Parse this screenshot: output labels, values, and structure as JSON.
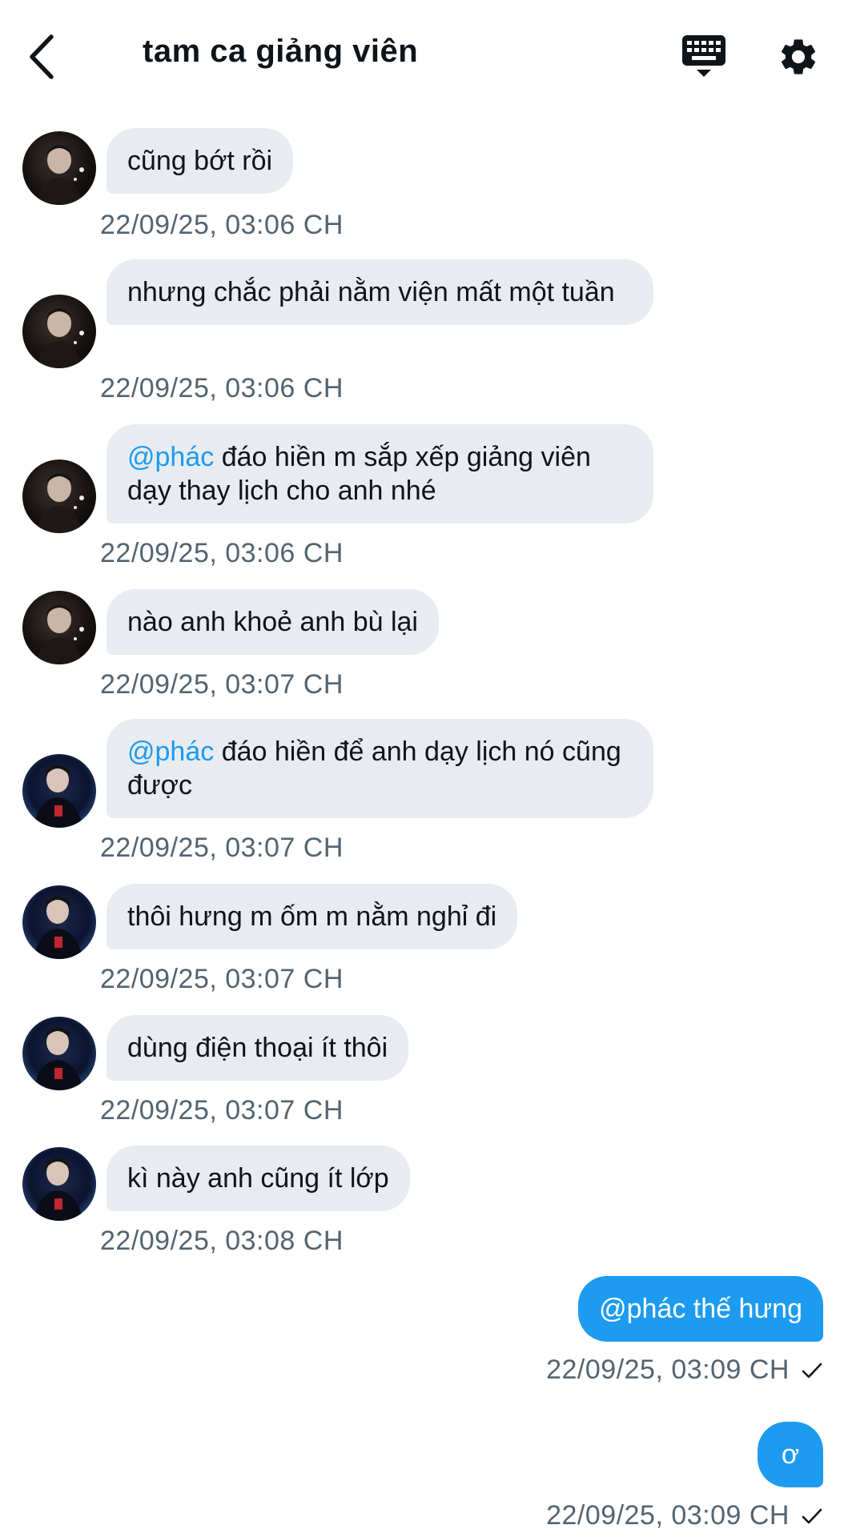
{
  "header": {
    "title": "tam ca giảng viên"
  },
  "messages": [
    {
      "sender": "a1",
      "text": "cũng bớt rồi",
      "time": "22/09/25, 03:06 CH"
    },
    {
      "sender": "a1",
      "text": "nhưng chắc phải nằm viện mất một tuần",
      "time": "22/09/25, 03:06 CH"
    },
    {
      "sender": "a1",
      "mention": "@phác",
      "text": " đáo hiền m sắp xếp giảng viên dạy thay lịch cho anh nhé",
      "time": "22/09/25, 03:06 CH"
    },
    {
      "sender": "a1",
      "text": "nào anh khoẻ anh bù lại",
      "time": "22/09/25, 03:07 CH"
    },
    {
      "sender": "a2",
      "mention": "@phác",
      "text": " đáo hiền để anh dạy lịch nó cũng được",
      "time": "22/09/25, 03:07 CH"
    },
    {
      "sender": "a2",
      "text": "thôi hưng m ốm m nằm nghỉ đi",
      "time": "22/09/25, 03:07 CH"
    },
    {
      "sender": "a2",
      "text": "dùng điện thoại ít thôi",
      "time": "22/09/25, 03:07 CH"
    },
    {
      "sender": "a2",
      "text": "kì này anh cũng ít lớp",
      "time": "22/09/25, 03:08 CH"
    }
  ],
  "outgoing": [
    {
      "text": "@phác thế hưng",
      "time": "22/09/25, 03:09 CH"
    },
    {
      "text": "ơ",
      "time": "22/09/25, 03:09 CH"
    }
  ],
  "colors": {
    "accent": "#1d9bf0",
    "bubble_in": "#e8ecf0",
    "timestamp": "#536471"
  }
}
